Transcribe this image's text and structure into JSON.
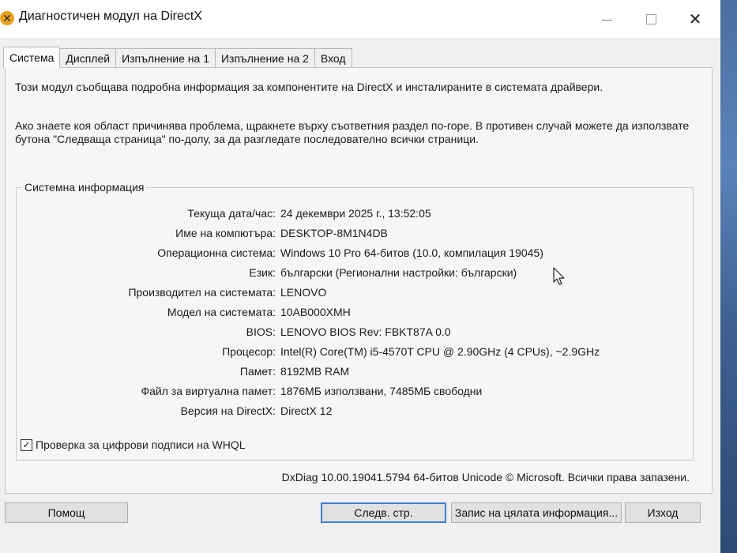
{
  "window": {
    "title": "Диагностичен модул на DirectX",
    "icon": "directx-x-icon",
    "controls": {
      "minimize": "minimize-icon",
      "maximize": "maximize-icon",
      "close": "✕"
    }
  },
  "tabs": [
    {
      "label": "Система",
      "active": true
    },
    {
      "label": "Дисплей",
      "active": false
    },
    {
      "label": "Изпълнение на 1",
      "active": false
    },
    {
      "label": "Изпълнение на 2",
      "active": false
    },
    {
      "label": "Вход",
      "active": false
    }
  ],
  "intro": {
    "line1": "Този модул съобщава подробна информация за компонентите на DirectX и инсталираните в системата драйвери.",
    "line2": "Ако знаете коя област причинява проблема, щракнете върху съответния раздел по-горе. В противен случай можете да използвате бутона \"Следваща страница\" по-долу, за да разгледате последователно всички страници."
  },
  "system_info": {
    "title": "Системна информация",
    "rows": [
      {
        "label": "Текуща дата/час:",
        "value": "24 декември 2025 г., 13:52:05"
      },
      {
        "label": "Име на компютъра:",
        "value": "DESKTOP-8M1N4DB"
      },
      {
        "label": "Операционна система:",
        "value": "Windows 10 Pro 64-битов (10.0, компилация 19045)"
      },
      {
        "label": "Език:",
        "value": "български (Регионални настройки: български)"
      },
      {
        "label": "Производител на системата:",
        "value": "LENOVO"
      },
      {
        "label": "Модел на системата:",
        "value": "10AB000XMH"
      },
      {
        "label": "BIOS:",
        "value": "LENOVO BIOS Rev: FBKT87A 0.0"
      },
      {
        "label": "Процесор:",
        "value": "Intel(R) Core(TM) i5-4570T CPU @ 2.90GHz (4 CPUs), ~2.9GHz"
      },
      {
        "label": "Памет:",
        "value": "8192MB RAM"
      },
      {
        "label": "Файл за виртуална памет:",
        "value": "1876МБ използвани, 7485МБ свободни"
      },
      {
        "label": "Версия на DirectX:",
        "value": "DirectX 12"
      }
    ]
  },
  "whql": {
    "label": "Проверка за цифрови подписи на WHQL",
    "checked": true,
    "check_glyph": "✓"
  },
  "copyright": "DxDiag 10.00.19041.5794 64-битов Unicode © Microsoft. Всички права запазени.",
  "buttons": {
    "help": "Помощ",
    "next": "Следв. стр.",
    "save": "Запис на цялата информация...",
    "exit": "Изход"
  },
  "colors": {
    "focus_border": "#3c7fd4",
    "icon_accent": "#e8a21c"
  }
}
